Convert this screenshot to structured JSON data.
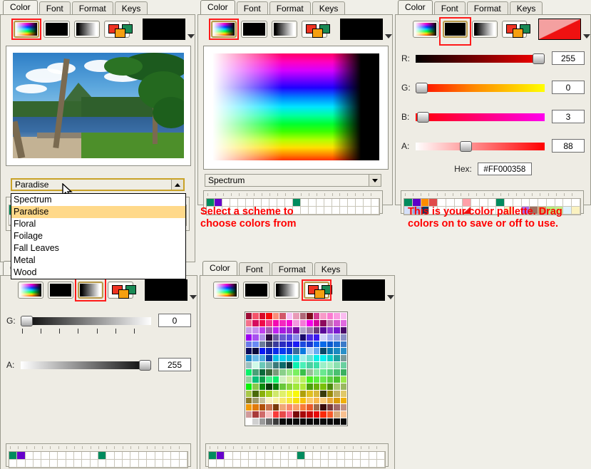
{
  "tabs": [
    "Color",
    "Font",
    "Format",
    "Keys"
  ],
  "mode_icons": [
    "spectrum-mode-icon",
    "rgb-sliders-mode-icon",
    "grayscale-mode-icon",
    "swatch-grid-mode-icon"
  ],
  "panels": {
    "scheme": {
      "active_tab": "Color",
      "selected_mode": 0,
      "preview_color": "#000000",
      "combo_value": "Paradise",
      "combo_open": true,
      "options": [
        "Spectrum",
        "Paradise",
        "Floral",
        "Foilage",
        "Fall Leaves",
        "Metal",
        "Wood"
      ],
      "selected_option": "Paradise",
      "image_name": "paradise-photo"
    },
    "spectrum": {
      "active_tab": "Color",
      "selected_mode": 0,
      "preview_color": "#000000",
      "combo_value": "Spectrum",
      "combo_open": false,
      "annotation_line1": "Select a scheme to",
      "annotation_line2": "choose colors from",
      "strip_swatches": [
        {
          "index": 0,
          "color": "#008b5e"
        },
        {
          "index": 1,
          "color": "#6600cc"
        },
        {
          "index": 11,
          "color": "#008b5e"
        }
      ]
    },
    "rgb": {
      "active_tab": "Color",
      "selected_mode": 1,
      "preview_color": "#FF0003",
      "preview_alpha": 88,
      "sliders": [
        {
          "label": "R:",
          "value": 255,
          "percent": 100,
          "gradient": "linear-gradient(to right,#000000,#ff0000)"
        },
        {
          "label": "G:",
          "value": 0,
          "percent": 0,
          "gradient": "linear-gradient(to right,#ff0000,#ff8000 45%,#ffff00)"
        },
        {
          "label": "B:",
          "value": 3,
          "percent": 1,
          "gradient": "linear-gradient(to right,#ff0000,#ff00ff)"
        },
        {
          "label": "A:",
          "value": 88,
          "percent": 34,
          "gradient": "linear-gradient(to right,#ffffff,#ff0000)"
        }
      ],
      "hex_label": "Hex:",
      "hex_value": "#FF000358",
      "annotation_line1": "This is your color pallette. Drag",
      "annotation_line2": "colors on to save or off to use.",
      "palette_row1": [
        {
          "index": 0,
          "color": "#008b5e"
        },
        {
          "index": 1,
          "color": "#5c00c8"
        },
        {
          "index": 2,
          "color": "#ff8c00"
        },
        {
          "index": 3,
          "color": "#e04a4a"
        },
        {
          "index": 7,
          "color": "#ffa0a8"
        },
        {
          "index": 11,
          "color": "#008b5e"
        }
      ],
      "palette_row2": [
        {
          "index": 0,
          "color": "#d4e0fa"
        },
        {
          "index": 1,
          "color": "#8fa8f0"
        },
        {
          "index": 2,
          "color": "#0b3a63"
        },
        {
          "index": 7,
          "color": "#ee1111"
        },
        {
          "index": 12,
          "color": "#fbefb8"
        },
        {
          "index": 14,
          "color": "#a86ef0"
        },
        {
          "index": 15,
          "color": "#a07060"
        },
        {
          "index": 16,
          "color": "#cfa064"
        },
        {
          "index": 17,
          "color": "#b6f07a"
        },
        {
          "index": 18,
          "color": "#c0ee88"
        },
        {
          "index": 19,
          "color": "#dff2fb"
        },
        {
          "index": 20,
          "color": "#fbf2c0"
        }
      ]
    },
    "grayscale": {
      "active_tab": "Format",
      "selected_mode": 2,
      "preview_color": "#000000",
      "sliders": [
        {
          "label": "G:",
          "value": 0,
          "percent": 0,
          "gradient": "linear-gradient(to right,#000000,#ffffff)"
        },
        {
          "label": "A:",
          "value": 255,
          "percent": 100,
          "gradient": "linear-gradient(to right,#ffffff,#000000)"
        }
      ],
      "strip_swatches": [
        {
          "index": 0,
          "color": "#008b5e"
        },
        {
          "index": 1,
          "color": "#6600cc"
        },
        {
          "index": 11,
          "color": "#008b5e"
        }
      ]
    },
    "swatchgrid": {
      "active_tab": "Color",
      "selected_mode": 3,
      "preview_color": "#000000",
      "grid_columns": 15,
      "grid_rows": 21,
      "strip_swatches": [
        {
          "index": 0,
          "color": "#008b5e"
        },
        {
          "index": 1,
          "color": "#6600cc"
        },
        {
          "index": 11,
          "color": "#008b5e"
        }
      ],
      "grid_colors": [
        [
          "#9e0b35",
          "#f4546a",
          "#d80a2a",
          "#f50d0d",
          "#fa8e7a",
          "#d2566a",
          "#f7c0f7",
          "#e89ab6",
          "#b06878",
          "#7e0a1e",
          "#d43a8e",
          "#f79ac8",
          "#fa7ad0",
          "#fa9ae0",
          "#fabcf0"
        ],
        [
          "#f4708a",
          "#d60c5e",
          "#f00a4a",
          "#f43a8a",
          "#f40ab0",
          "#f428c0",
          "#f40ad0",
          "#f498e0",
          "#f47ad8",
          "#f400e8",
          "#d6009e",
          "#8e0a5e",
          "#c078b0",
          "#d458d0",
          "#e06ae0"
        ],
        [
          "#c8a0e8",
          "#c890f0",
          "#c040f0",
          "#a05ab0",
          "#c020f0",
          "#a81ae0",
          "#9a28d0",
          "#7a0aa0",
          "#b0a0c8",
          "#9a7aa8",
          "#6a3a7a",
          "#5a0a9a",
          "#8a3ad0",
          "#7a1ad0",
          "#4a0a6a"
        ],
        [
          "#9a00f0",
          "#a850f0",
          "#b090e8",
          "#2a0a3a",
          "#6a5aa0",
          "#6a5ad0",
          "#5a4ae0",
          "#8a8ae8",
          "#1a0a6a",
          "#4a2ae0",
          "#3a1af0",
          "#d0d0fa",
          "#a0a8f0",
          "#9aa0e0",
          "#8a90c8"
        ],
        [
          "#6a7ae8",
          "#6a8af4",
          "#6a7a9a",
          "#3a3a6a",
          "#3a3a9a",
          "#2a2ac0",
          "#2020d0",
          "#1a1af4",
          "#1a4ae0",
          "#1a3ad0",
          "#1060f0",
          "#0a6ae8",
          "#0a5ad0",
          "#1a6ad0",
          "#3a7ac8"
        ],
        [
          "#0a0a5a",
          "#0a0a3a",
          "#0a1af4",
          "#0a20c0",
          "#0a2ae8",
          "#0a3af0",
          "#0a3ad0",
          "#3a6a9a",
          "#0a7ae0",
          "#b0d0f0",
          "#6aaaf0",
          "#0a4a6a",
          "#0a7ab0",
          "#1a8ac0",
          "#2a90c8"
        ],
        [
          "#1a8ac8",
          "#6abae8",
          "#4aaae0",
          "#0a3aa0",
          "#0ac0e8",
          "#0ad0f0",
          "#0ac0e0",
          "#0ad0e8",
          "#a0f0e8",
          "#6ae0d0",
          "#0af0e8",
          "#0af0f0",
          "#0ad0c8",
          "#1aa0a0",
          "#7a9a9a"
        ],
        [
          "#9ac0c0",
          "#d0fae8",
          "#6ac8b8",
          "#7ab0a8",
          "#3a7a7a",
          "#0a6a6a",
          "#0a3a3a",
          "#0af0b0",
          "#4af0b8",
          "#4ad0a0",
          "#3ae0a8",
          "#9af0c8",
          "#a8f0c0",
          "#8ae0b0",
          "#6ad0a0"
        ],
        [
          "#0af06a",
          "#4aa078",
          "#0a6a3a",
          "#3a6a3a",
          "#7a9a7a",
          "#8ad08a",
          "#9ae888",
          "#7af060",
          "#3ac04a",
          "#9ac09a",
          "#8ae8a0",
          "#6ae890",
          "#5ad080",
          "#4ac070",
          "#3ab060"
        ],
        [
          "#9ad0a0",
          "#0ac078",
          "#0aa04a",
          "#4af08a",
          "#0af06a",
          "#d0f0c0",
          "#d8f0a0",
          "#c8f080",
          "#b8f060",
          "#4af020",
          "#5af040",
          "#6ae850",
          "#5ad040",
          "#4ac030",
          "#9ae84a"
        ],
        [
          "#0af00a",
          "#8ac84a",
          "#0a8a0a",
          "#0a3a0a",
          "#0a7a0a",
          "#6ac83a",
          "#8ad83a",
          "#a0e83a",
          "#b0e83a",
          "#4aa00a",
          "#6ab00a",
          "#7ac00a",
          "#4a8a0a",
          "#a8c870",
          "#9ab860"
        ],
        [
          "#a8c84a",
          "#4a6a0a",
          "#8ab00a",
          "#a8d020",
          "#d0e86a",
          "#e0f06a",
          "#f0f83a",
          "#f8f80a",
          "#b0a00a",
          "#e0c020",
          "#d8b83a",
          "#3a3a0a",
          "#9a8a0a",
          "#c0b060",
          "#e0c868"
        ],
        [
          "#8a7a2a",
          "#a09a6a",
          "#c8c098",
          "#f8f0c0",
          "#f8f0a0",
          "#f8e86a",
          "#f8e83a",
          "#f8e00a",
          "#f8c00a",
          "#f8c86a",
          "#f8b84a",
          "#f8c878",
          "#e8a83a",
          "#d89a0a",
          "#f0b008"
        ],
        [
          "#f09a0a",
          "#e07a0a",
          "#b0500a",
          "#c8704a",
          "#7a3a0a",
          "#f0a878",
          "#f88a6a",
          "#f8a068",
          "#f87a3a",
          "#e85a2a",
          "#a06a4a",
          "#3a0a0a",
          "#7a3a3a",
          "#a06868",
          "#c09080"
        ],
        [
          "#d09a9a",
          "#a83a3a",
          "#d06a6a",
          "#f8c0c0",
          "#f83a3a",
          "#e84a4a",
          "#f86a8a",
          "#7a0a0a",
          "#a80a0a",
          "#c80a0a",
          "#e80a0a",
          "#f82a0a",
          "#f85a2a",
          "#d8a878",
          "#f8c090"
        ],
        [
          "#ffffff",
          "#d0d0d0",
          "#9a9a9a",
          "#6a6a6a",
          "#3a3a3a",
          "#0a0a0a",
          "#0a0a0a",
          "#0a0a0a",
          "#0a0a0a",
          "#0a0a0a",
          "#0a0a0a",
          "#0a0a0a",
          "#0a0a0a",
          "#0a0a0a",
          "#0a0a0a"
        ]
      ]
    }
  }
}
